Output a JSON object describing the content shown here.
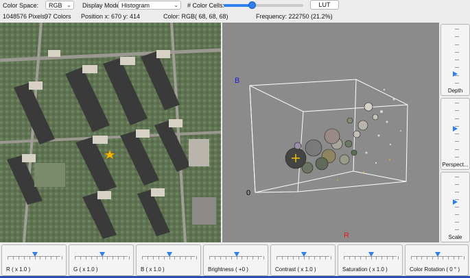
{
  "toolbar": {
    "color_space_label": "Color Space:",
    "color_space_value": "RGB",
    "display_mode_label": "Display Mode:",
    "display_mode_value": "Histogram",
    "color_cells_label": "# Color Cells:",
    "color_cells_level": 0.35,
    "lut_label": "LUT"
  },
  "info": {
    "pixels": "1048576 Pixels,",
    "colors": "97 Colors",
    "position": "Position x: 670 y: 414",
    "color": "Color:  RGB(  68,  68,  68)",
    "frequency": "Frequency: 222750 (21.2%)"
  },
  "plot": {
    "axis_b": "B",
    "axis_r": "R",
    "origin": "0",
    "colors": {
      "b": "#1c1cd6",
      "r": "#e01c1c",
      "background": "#8b8b8b"
    }
  },
  "side_sliders": [
    {
      "label": "Depth",
      "level": 0.18
    },
    {
      "label": "Perspect...",
      "level": 0.55
    },
    {
      "label": "Scale",
      "level": 0.55
    }
  ],
  "bottom_sliders": [
    {
      "label": "R ( x 1.0 )",
      "level": 0.5
    },
    {
      "label": "G ( x 1.0 )",
      "level": 0.5
    },
    {
      "label": "B ( x 1.0 )",
      "level": 0.5
    },
    {
      "label": "Brightness ( +0 )",
      "level": 0.5
    },
    {
      "label": "Contrast ( x 1.0 )",
      "level": 0.5
    },
    {
      "label": "Saturation ( x 1.0 )",
      "level": 0.5
    },
    {
      "label": "Color Rotation ( 0 ° )",
      "level": 0.5
    }
  ],
  "icons": {
    "chevron": "chevron-down-icon",
    "crosshair": "crosshair-icon",
    "marker": "star-icon"
  }
}
